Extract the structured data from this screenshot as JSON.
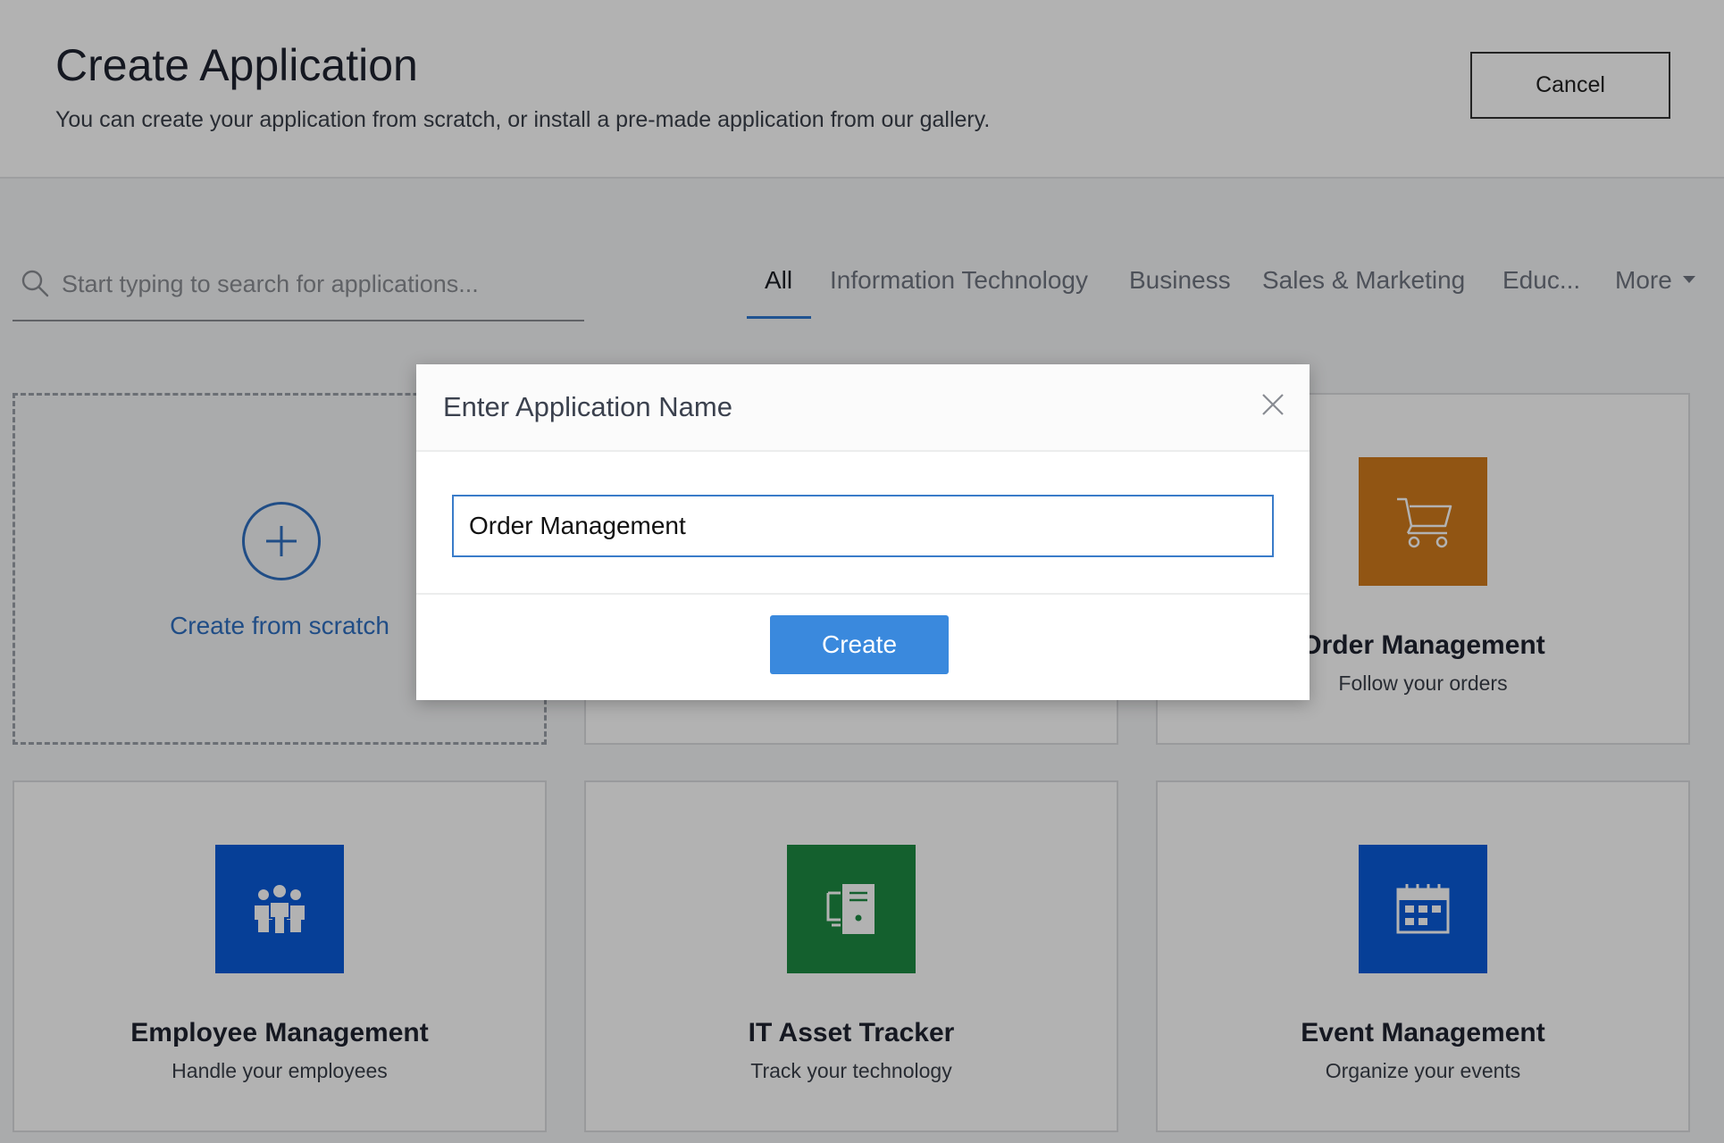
{
  "header": {
    "title": "Create Application",
    "subtitle": "You can create your application from scratch, or install a pre-made application from our gallery.",
    "cancel_label": "Cancel"
  },
  "search": {
    "placeholder": "Start typing to search for applications..."
  },
  "tabs": [
    {
      "label": "All",
      "active": true
    },
    {
      "label": "Information Technology",
      "active": false
    },
    {
      "label": "Business",
      "active": false
    },
    {
      "label": "Sales & Marketing",
      "active": false
    },
    {
      "label": "Educ...",
      "active": false
    },
    {
      "label": "More",
      "active": false
    }
  ],
  "scratch_card": {
    "label": "Create from scratch"
  },
  "cards": [
    {
      "title": "Order Management",
      "subtitle": "Follow your orders",
      "color": "#d07a1c",
      "icon": "shopping-cart-icon"
    },
    {
      "title": "Employee Management",
      "subtitle": "Handle your employees",
      "color": "#0a5bd8",
      "icon": "people-group-icon"
    },
    {
      "title": "IT Asset Tracker",
      "subtitle": "Track your technology",
      "color": "#1d8a43",
      "icon": "computer-asset-icon"
    },
    {
      "title": "Event Management",
      "subtitle": "Organize your events",
      "color": "#0a5bd8",
      "icon": "calendar-icon"
    }
  ],
  "modal": {
    "title": "Enter Application Name",
    "input_value": "Order Management",
    "create_label": "Create"
  },
  "colors": {
    "accent": "#3a89dd",
    "link": "#2f6fc0",
    "overlay": "rgba(0,0,0,0.30)"
  }
}
